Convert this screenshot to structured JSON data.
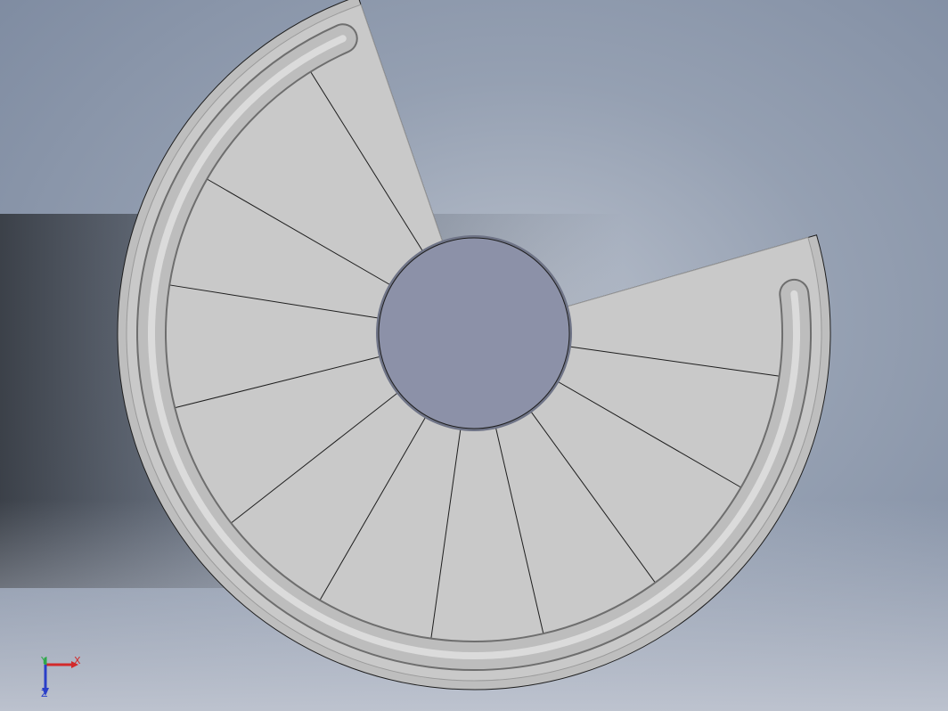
{
  "viewport": {
    "background_top": "#8E9EB5",
    "background_mid": "#5F6878",
    "background_bottom": "#C3C8D3",
    "model_face_color": "#C9C9C9",
    "model_edge_color": "#1E1E1E",
    "core_color": "#8C91A8",
    "rail_color": "#BDBDBD"
  },
  "model": {
    "name": "spiral-staircase",
    "step_count": 12
  },
  "triad": {
    "x_label": "X",
    "y_label": "Y",
    "z_label": "Z",
    "x_color": "#D22A2A",
    "y_color": "#2EA84A",
    "z_color": "#2A3FC8"
  }
}
